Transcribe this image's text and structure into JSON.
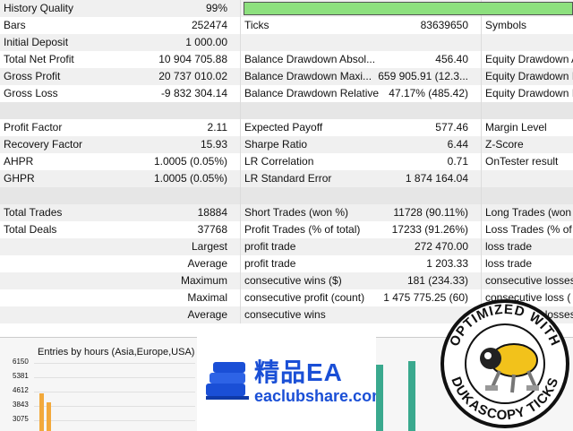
{
  "rows": [
    {
      "c1": "History Quality",
      "c2": "99%",
      "c3": "",
      "c4": "",
      "c5": ""
    },
    {
      "c1": "Bars",
      "c2": "252474",
      "c3": "Ticks",
      "c4": "83639650",
      "c5": "Symbols"
    },
    {
      "c1": "Initial Deposit",
      "c2": "1 000.00",
      "c3": "",
      "c4": "",
      "c5": ""
    },
    {
      "c1": "Total Net Profit",
      "c2": "10 904 705.88",
      "c3": "Balance Drawdown Absol...",
      "c4": "456.40",
      "c5": "Equity Drawdown A"
    },
    {
      "c1": "Gross Profit",
      "c2": "20 737 010.02",
      "c3": "Balance Drawdown Maxi...",
      "c4": "659 905.91 (12.3...",
      "c5": "Equity Drawdown I"
    },
    {
      "c1": "Gross Loss",
      "c2": "-9 832 304.14",
      "c3": "Balance Drawdown Relative",
      "c4": "47.17% (485.42)",
      "c5": "Equity Drawdown I"
    },
    {
      "c1": "",
      "c2": "",
      "c3": "",
      "c4": "",
      "c5": ""
    },
    {
      "c1": "Profit Factor",
      "c2": "2.11",
      "c3": "Expected Payoff",
      "c4": "577.46",
      "c5": "Margin Level"
    },
    {
      "c1": "Recovery Factor",
      "c2": "15.93",
      "c3": "Sharpe Ratio",
      "c4": "6.44",
      "c5": "Z-Score"
    },
    {
      "c1": "AHPR",
      "c2": "1.0005 (0.05%)",
      "c3": "LR Correlation",
      "c4": "0.71",
      "c5": "OnTester result"
    },
    {
      "c1": "GHPR",
      "c2": "1.0005 (0.05%)",
      "c3": "LR Standard Error",
      "c4": "1 874 164.04",
      "c5": ""
    },
    {
      "c1": "",
      "c2": "",
      "c3": "",
      "c4": "",
      "c5": ""
    },
    {
      "c1": "Total Trades",
      "c2": "18884",
      "c3": "Short Trades (won %)",
      "c4": "11728 (90.11%)",
      "c5": "Long Trades (won '"
    },
    {
      "c1": "Total Deals",
      "c2": "37768",
      "c3": "Profit Trades (% of total)",
      "c4": "17233 (91.26%)",
      "c5": "Loss Trades (% of t"
    },
    {
      "c1": "",
      "c2": "Largest",
      "c3": "profit trade",
      "c4": "272 470.00",
      "c5": "loss trade"
    },
    {
      "c1": "",
      "c2": "Average",
      "c3": "profit trade",
      "c4": "1 203.33",
      "c5": "loss trade"
    },
    {
      "c1": "",
      "c2": "Maximum",
      "c3": "consecutive wins ($)",
      "c4": "181 (234.33)",
      "c5": "consecutive losses"
    },
    {
      "c1": "",
      "c2": "Maximal",
      "c3": "consecutive profit (count)",
      "c4": "1 475 775.25 (60)",
      "c5": "consecutive loss ("
    },
    {
      "c1": "",
      "c2": "Average",
      "c3": "consecutive wins",
      "c4": "",
      "c5": "consecutive losses"
    }
  ],
  "history_quality_fill": 0.99,
  "chart": {
    "title": "Entries by hours (Asia,Europe,USA)",
    "yticks": [
      "6150",
      "5381",
      "4612",
      "3843",
      "3075"
    ]
  },
  "watermark": {
    "brand_cn": "精品EA",
    "url": "eaclubshare.com"
  },
  "badge": {
    "top_text": "OPTIMIZED WITH",
    "bottom_text": "DUKASCOPY TICKS"
  },
  "colors": {
    "quality_bar": "#8de07e",
    "bar_orange": "#f2a93b",
    "bar_teal": "#3aa98e",
    "brand_blue": "#1a4fd6"
  },
  "chart_data": {
    "type": "bar",
    "title": "Entries by hours (Asia,Europe,USA)",
    "ylim": [
      3075,
      6150
    ],
    "yticks": [
      6150,
      5381,
      4612,
      3843,
      3075
    ],
    "series": [
      {
        "name": "",
        "values": [
          4612,
          3843
        ]
      }
    ]
  }
}
